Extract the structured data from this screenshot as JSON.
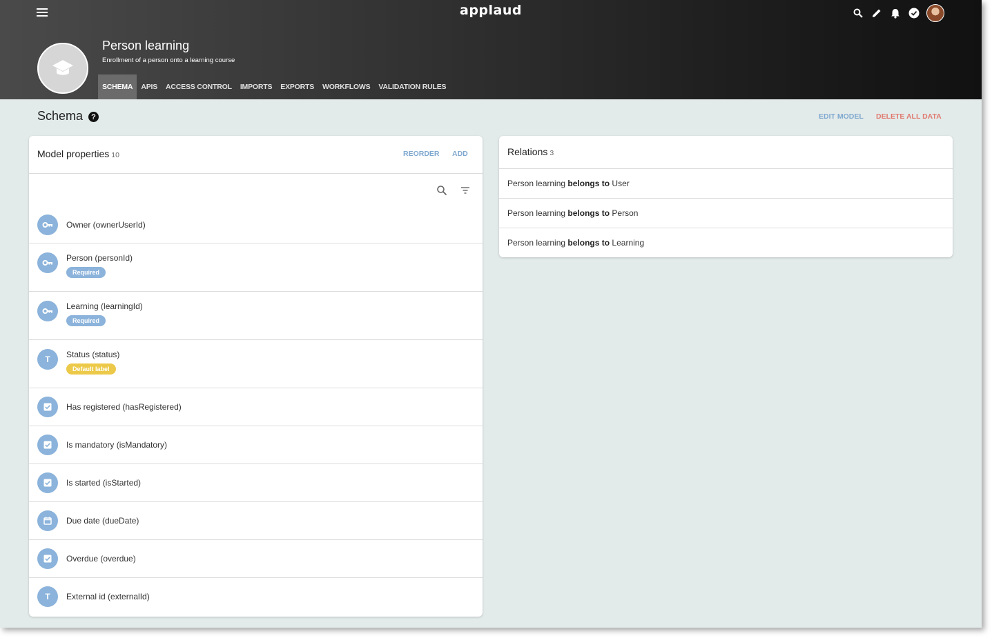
{
  "header": {
    "logo": "applaud",
    "icons": [
      "menu-icon",
      "search-icon",
      "pencil-icon",
      "bell-icon",
      "check-circle-icon",
      "user-avatar"
    ],
    "model_icon": "graduation-cap-icon",
    "title": "Person learning",
    "subtitle": "Enrollment of a person onto a learning course",
    "tabs": [
      {
        "label": "SCHEMA",
        "active": true
      },
      {
        "label": "APIS",
        "active": false
      },
      {
        "label": "ACCESS CONTROL",
        "active": false
      },
      {
        "label": "IMPORTS",
        "active": false
      },
      {
        "label": "EXPORTS",
        "active": false
      },
      {
        "label": "WORKFLOWS",
        "active": false
      },
      {
        "label": "VALIDATION RULES",
        "active": false
      }
    ]
  },
  "schema": {
    "title": "Schema",
    "help_icon": "?",
    "edit_model": "EDIT MODEL",
    "delete_all": "DELETE ALL DATA"
  },
  "properties": {
    "title": "Model properties",
    "count": "10",
    "reorder": "REORDER",
    "add": "ADD",
    "items": [
      {
        "name": "Owner (ownerUserId)",
        "icon": "key-icon",
        "badge": ""
      },
      {
        "name": "Person (personId)",
        "icon": "key-icon",
        "badge": "Required"
      },
      {
        "name": "Learning (learningId)",
        "icon": "key-icon",
        "badge": "Required"
      },
      {
        "name": "Status (status)",
        "icon": "text-icon",
        "badge": "Default label"
      },
      {
        "name": "Has registered (hasRegistered)",
        "icon": "checkbox-icon",
        "badge": ""
      },
      {
        "name": "Is mandatory (isMandatory)",
        "icon": "checkbox-icon",
        "badge": ""
      },
      {
        "name": "Is started (isStarted)",
        "icon": "checkbox-icon",
        "badge": ""
      },
      {
        "name": "Due date (dueDate)",
        "icon": "calendar-icon",
        "badge": ""
      },
      {
        "name": "Overdue (overdue)",
        "icon": "checkbox-icon",
        "badge": ""
      },
      {
        "name": "External id (externalId)",
        "icon": "text-icon",
        "badge": ""
      }
    ]
  },
  "relations": {
    "title": "Relations",
    "count": "3",
    "items": [
      {
        "subject": "Person learning",
        "verb": "belongs to",
        "target": "User"
      },
      {
        "subject": "Person learning",
        "verb": "belongs to",
        "target": "Person"
      },
      {
        "subject": "Person learning",
        "verb": "belongs to",
        "target": "Learning"
      }
    ]
  },
  "colors": {
    "accent_blue": "#8bb3db",
    "link_blue": "#7fa8cf",
    "danger": "#e07a70",
    "badge_yellow": "#ecc948",
    "page_bg": "#e3ebea"
  }
}
